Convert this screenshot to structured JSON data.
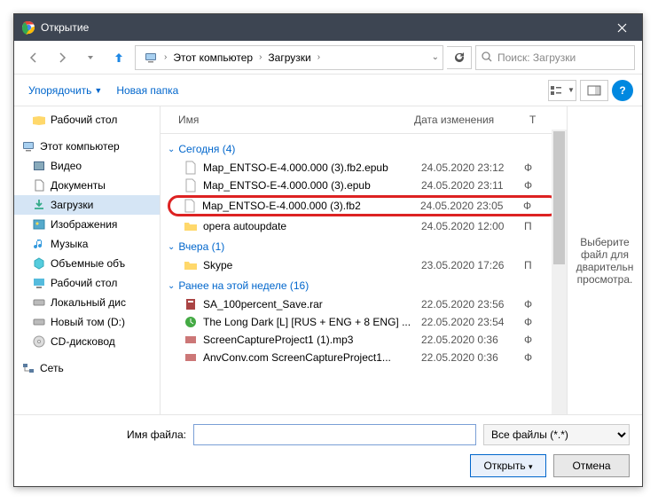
{
  "title": "Открытие",
  "breadcrumb": {
    "root": "Этот компьютер",
    "folder": "Загрузки"
  },
  "search": {
    "placeholder": "Поиск: Загрузки"
  },
  "toolbar": {
    "organize": "Упорядочить",
    "newfolder": "Новая папка"
  },
  "columns": {
    "name": "Имя",
    "date": "Дата изменения",
    "type": "Т"
  },
  "tree": {
    "desktop": "Рабочий стол",
    "thispc": "Этот компьютер",
    "videos": "Видео",
    "documents": "Документы",
    "downloads": "Загрузки",
    "pictures": "Изображения",
    "music": "Музыка",
    "objects3d": "Объемные объ",
    "desktop2": "Рабочий стол",
    "localdisc": "Локальный дис",
    "newvol": "Новый том (D:)",
    "cd": "CD-дисковод",
    "network": "Сеть"
  },
  "groups": {
    "today": "Сегодня (4)",
    "yesterday": "Вчера (1)",
    "earlier": "Ранее на этой неделе (16)"
  },
  "files": {
    "today": [
      {
        "name": "Map_ENTSO-E-4.000.000 (3).fb2.epub",
        "date": "24.05.2020 23:12",
        "type": "Ф"
      },
      {
        "name": "Map_ENTSO-E-4.000.000 (3).epub",
        "date": "24.05.2020 23:11",
        "type": "Ф"
      },
      {
        "name": "Map_ENTSO-E-4.000.000 (3).fb2",
        "date": "24.05.2020 23:05",
        "type": "Ф"
      },
      {
        "name": "opera autoupdate",
        "date": "24.05.2020 12:00",
        "type": "П"
      }
    ],
    "yesterday": [
      {
        "name": "Skype",
        "date": "23.05.2020 17:26",
        "type": "П"
      }
    ],
    "earlier": [
      {
        "name": "SA_100percent_Save.rar",
        "date": "22.05.2020 23:56",
        "type": "Ф"
      },
      {
        "name": "The Long Dark [L] [RUS + ENG + 8 ENG] ...",
        "date": "22.05.2020 23:54",
        "type": "Ф"
      },
      {
        "name": "ScreenCaptureProject1 (1).mp3",
        "date": "22.05.2020 0:36",
        "type": "Ф"
      },
      {
        "name": "AnvConv.com   ScreenCaptureProject1...",
        "date": "22.05.2020 0:36",
        "type": "Ф"
      }
    ]
  },
  "preview": "Выберите файл для дварительн просмотра.",
  "footer": {
    "filename_label": "Имя файла:",
    "filter": "Все файлы (*.*)",
    "open": "Открыть",
    "cancel": "Отмена"
  }
}
